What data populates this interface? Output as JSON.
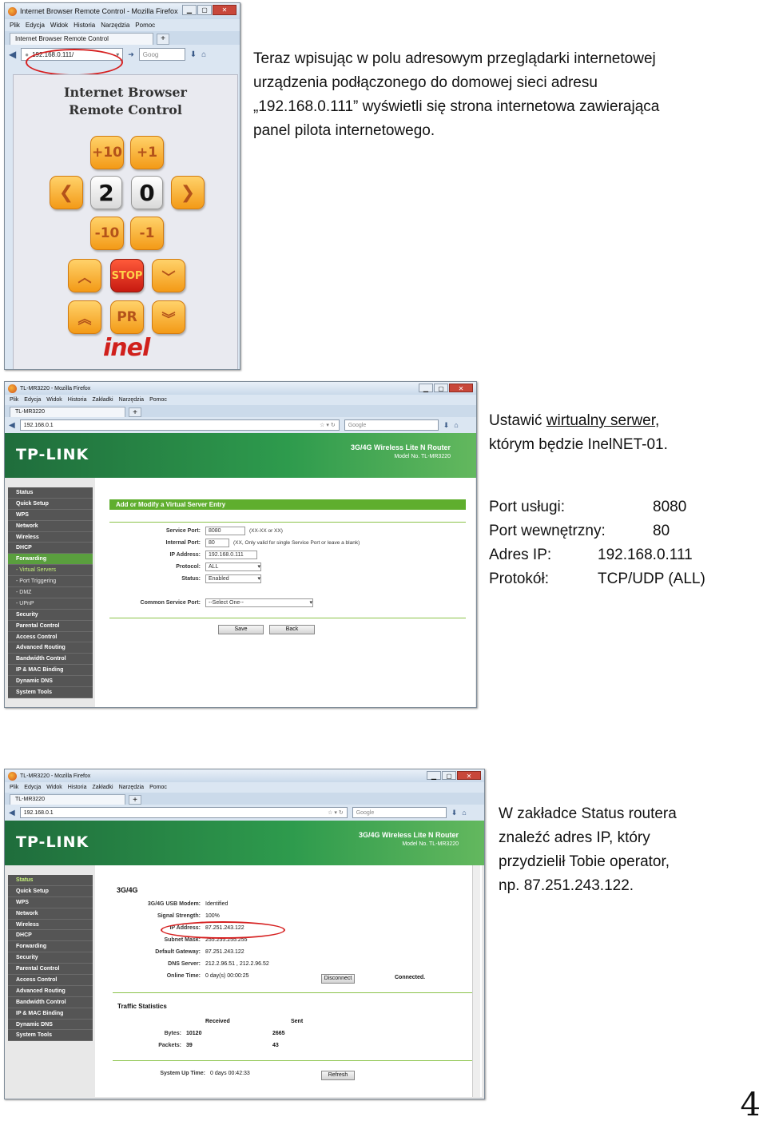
{
  "browser1": {
    "title": "Internet Browser Remote Control - Mozilla Firefox",
    "menu": [
      "Plik",
      "Edycja",
      "Widok",
      "Historia",
      "Narzędzia",
      "Pomoc"
    ],
    "tab": "Internet Browser Remote Control",
    "url": "192.168.0.111/",
    "search": "Goog"
  },
  "remote": {
    "title_line1": "Internet Browser",
    "title_line2": "Remote Control",
    "plus10": "+10",
    "plus1": "+1",
    "left": "❮",
    "digit1": "2",
    "digit2": "0",
    "right": "❯",
    "minus10": "-10",
    "minus1": "-1",
    "up": "︿",
    "stop": "STOP",
    "down": "﹀",
    "pgup": "︽",
    "pr": "PR",
    "pgdown": "︾",
    "logo": "inel"
  },
  "browser2": {
    "title": "TL-MR3220 - Mozilla Firefox",
    "menu": [
      "Plik",
      "Edycja",
      "Widok",
      "Historia",
      "Zakładki",
      "Narzędzia",
      "Pomoc"
    ],
    "tab": "TL-MR3220",
    "url": "192.168.0.1",
    "search": "Google"
  },
  "router": {
    "logo": "TP-LINK",
    "model_name": "3G/4G Wireless Lite N Router",
    "model_no": "Model No. TL-MR3220"
  },
  "sidebar1": [
    "Status",
    "Quick Setup",
    "WPS",
    "Network",
    "Wireless",
    "DHCP",
    "Forwarding",
    "- Virtual Servers",
    "- Port Triggering",
    "- DMZ",
    "- UPnP",
    "Security",
    "Parental Control",
    "Access Control",
    "Advanced Routing",
    "Bandwidth Control",
    "IP & MAC Binding",
    "Dynamic DNS",
    "System Tools"
  ],
  "vserver": {
    "heading": "Add or Modify a Virtual Server Entry",
    "service_port_label": "Service Port:",
    "service_port": "8080",
    "service_port_note": "(XX-XX or XX)",
    "internal_port_label": "Internal Port:",
    "internal_port": "80",
    "internal_port_note": "(XX, Only valid for single Service Port or leave a blank)",
    "ip_label": "IP Address:",
    "ip": "192.168.0.111",
    "protocol_label": "Protocol:",
    "protocol": "ALL",
    "status_label": "Status:",
    "status": "Enabled",
    "common_label": "Common Service Port:",
    "common": "--Select One--",
    "save": "Save",
    "back": "Back"
  },
  "sidebar2": [
    "Status",
    "Quick Setup",
    "WPS",
    "Network",
    "Wireless",
    "DHCP",
    "Forwarding",
    "Security",
    "Parental Control",
    "Access Control",
    "Advanced Routing",
    "Bandwidth Control",
    "IP & MAC Binding",
    "Dynamic DNS",
    "System Tools"
  ],
  "status": {
    "section": "3G/4G",
    "modem_label": "3G/4G USB Modem:",
    "modem": "Identified",
    "signal_label": "Signal Strength:",
    "signal": "100%",
    "ip_label": "IP Address:",
    "ip": "87.251.243.122",
    "mask_label": "Subnet Mask:",
    "mask": "255.255.255.255",
    "gateway_label": "Default Gateway:",
    "gateway": "87.251.243.122",
    "dns_label": "DNS Server:",
    "dns": "212.2.96.51 , 212.2.96.52",
    "online_label": "Online Time:",
    "online": "0 day(s) 00:00:25",
    "disconnect": "Disconnect",
    "connected": "Connected.",
    "traffic_title": "Traffic Statistics",
    "received_h": "Received",
    "sent_h": "Sent",
    "bytes_label": "Bytes:",
    "bytes_rx": "10120",
    "bytes_tx": "2665",
    "packets_label": "Packets:",
    "packets_rx": "39",
    "packets_tx": "43",
    "uptime_label": "System Up Time:",
    "uptime": "0 days 00:42:33",
    "refresh": "Refresh"
  },
  "text1": {
    "line1": "Teraz wpisując w polu adresowym przeglądarki internetowej",
    "line2": "urządzenia podłączonego do domowej sieci adresu",
    "line3": "„192.168.0.111” wyświetli się strona internetowa zawierająca",
    "line4": "panel pilota internetowego."
  },
  "text2": {
    "pre": "Ustawić ",
    "link": "wirtualny serwer",
    "post": ",",
    "line2": "którym będzie InelNET-01."
  },
  "settings": {
    "r1_label": "Port usługi:",
    "r1_value": "8080",
    "r2_label": "Port wewnętrzny:",
    "r2_value": "80",
    "r3_label": "Adres IP:",
    "r3_value": "192.168.0.111",
    "r4_label": "Protokół:",
    "r4_value": "TCP/UDP (ALL)"
  },
  "text3": {
    "line1": "W zakładce Status routera",
    "line2": "znaleźć adres IP, który",
    "line3": "przydzielił Tobie operator,",
    "line4": "np. 87.251.243.122."
  },
  "page_number": "4"
}
